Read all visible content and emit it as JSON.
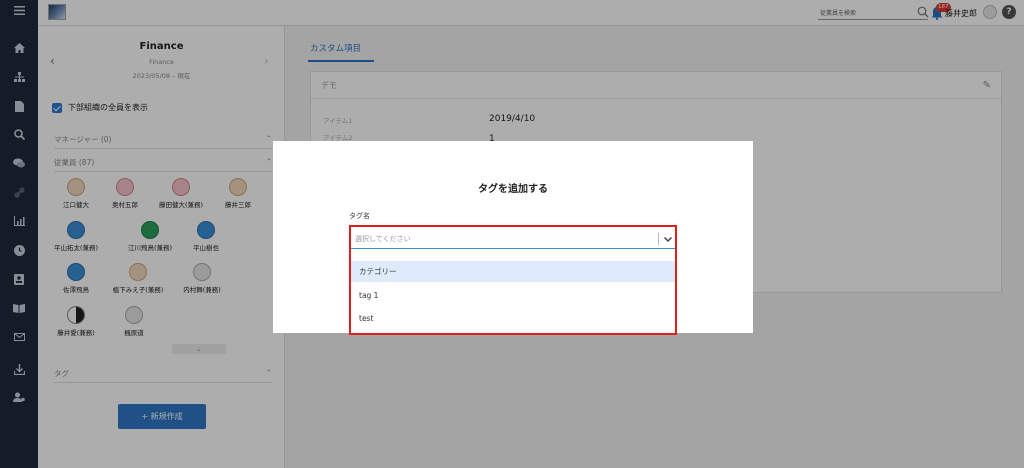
{
  "topbar": {
    "search_placeholder": "従業員を検索",
    "notification_count": "187",
    "user_name": "藤井史郎",
    "help_label": "?"
  },
  "org": {
    "name": "Finance",
    "sub": "Finance",
    "date": "2023/05/08 – 現在",
    "show_all_label": "下部組織の全員を表示",
    "managers_label": "マネージャー (0)",
    "employees_label": "従業員 (87)",
    "members": [
      {
        "name": "江口健大"
      },
      {
        "name": "奥村五郎"
      },
      {
        "name": "藤田健大(兼務)"
      },
      {
        "name": "藤井三郎"
      },
      {
        "name": "平山拓太(兼務)"
      },
      {
        "name": "江川飛鳥(兼務)"
      },
      {
        "name": "平山樹也"
      },
      {
        "name": "佐澤飛鳥"
      },
      {
        "name": "植下みえ子(兼務)"
      },
      {
        "name": "内村舞(兼務)"
      },
      {
        "name": "藤井愛(兼務)"
      },
      {
        "name": "楓原道"
      }
    ],
    "tags_label": "タグ",
    "new_button": "+ 新規作成"
  },
  "main": {
    "tab_label": "カスタム項目",
    "card_title": "デモ",
    "fields": [
      {
        "label": "アイテム1",
        "value": "2019/4/10"
      },
      {
        "label": "アイテム2",
        "value": "1"
      }
    ]
  },
  "modal": {
    "title": "タグを追加する",
    "field_label": "タグ名",
    "select_placeholder": "選択してください",
    "options": [
      "カテゴリー",
      "tag 1",
      "test"
    ]
  },
  "colors": {
    "accent": "#2a73c4",
    "nav_bg": "#1f2a3a",
    "highlight": "#e02020"
  }
}
